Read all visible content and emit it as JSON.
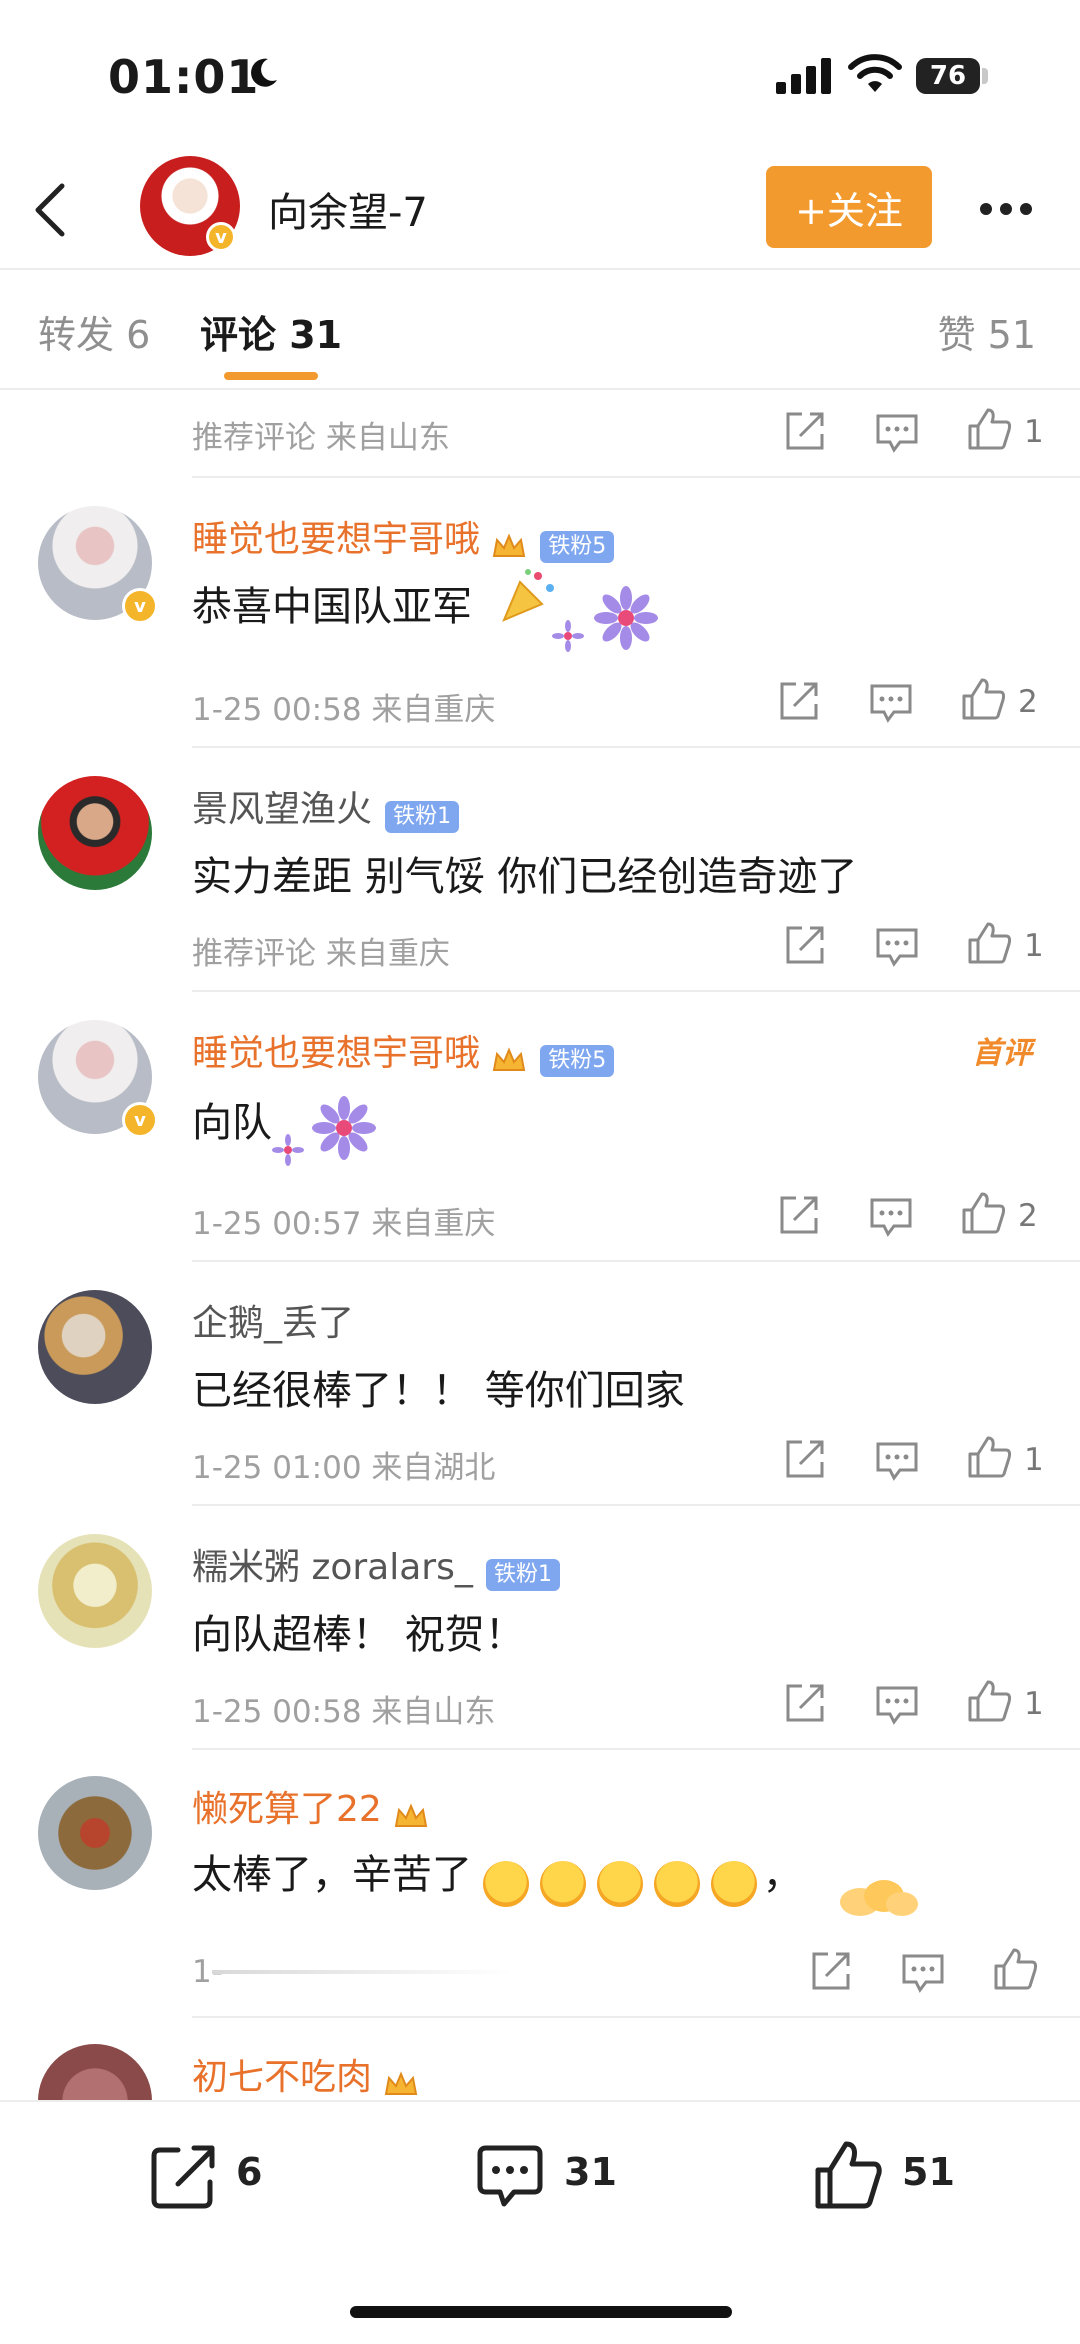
{
  "status": {
    "time": "01:01",
    "battery": "76"
  },
  "header": {
    "username": "向余望-7",
    "follow_label": "+关注"
  },
  "tabs": {
    "repost": "转发 6",
    "comment": "评论 31",
    "like": "赞 51"
  },
  "comments": [
    {
      "meta": "推荐评论  来自山东",
      "likes": "1"
    },
    {
      "name": "睡觉也要想宇哥哦",
      "badge": "铁粉5",
      "text": "恭喜中国队亚军",
      "meta": "1-25 00:58  来自重庆",
      "likes": "2"
    },
    {
      "name": "景风望渔火",
      "badge": "铁粉1",
      "text": "实力差距 别气馁 你们已经创造奇迹了",
      "meta": "推荐评论  来自重庆",
      "likes": "1"
    },
    {
      "name": "睡觉也要想宇哥哦",
      "badge": "铁粉5",
      "tag": "首评",
      "text": "向队",
      "meta": "1-25 00:57  来自重庆",
      "likes": "2"
    },
    {
      "name": "企鹅_丢了",
      "text": "已经很棒了！！ 等你们回家",
      "meta": "1-25 01:00  来自湖北",
      "likes": "1"
    },
    {
      "name": "糯米粥 zoralars_",
      "badge": "铁粉1",
      "text": "向队超棒！ 祝贺！",
      "meta": "1-25 00:58  来自山东",
      "likes": "1"
    },
    {
      "name": "懒死算了22",
      "text": "太棒了，辛苦了",
      "text_tail": "，",
      "meta": "1-"
    },
    {
      "name": "初七不吃肉"
    }
  ],
  "bottom_bar": {
    "repost_count": "6",
    "comment_count": "31",
    "like_count": "51"
  },
  "colors": {
    "accent": "#f39a2e",
    "name_orange": "#e8722b",
    "fan_badge": "#7fa7f0",
    "verified": "#f4b52b"
  },
  "icons": [
    "moon-icon",
    "signal-icon",
    "wifi-icon",
    "back-icon",
    "more-icon",
    "share-icon",
    "comment-icon",
    "like-icon",
    "crown-icon",
    "flower-icon",
    "emoji-icon"
  ]
}
